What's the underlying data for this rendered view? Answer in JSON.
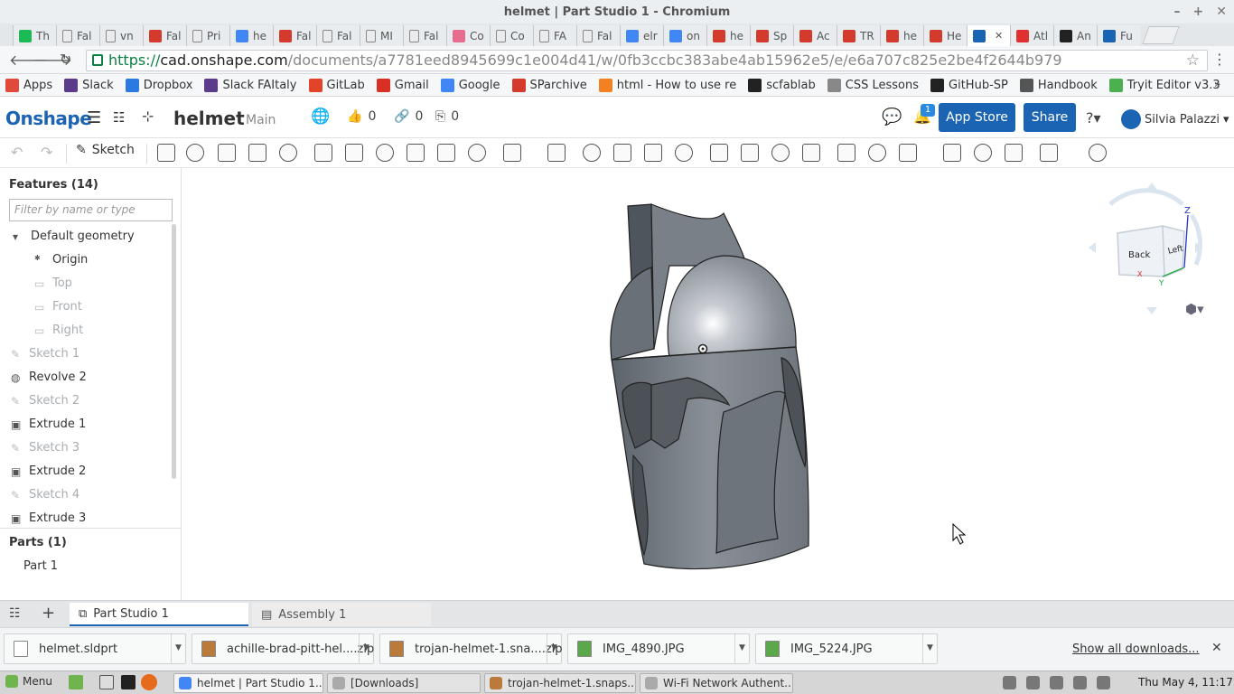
{
  "window": {
    "title": "helmet | Part Studio 1 - Chromium"
  },
  "browser_tabs": [
    {
      "label": "Th",
      "icon": "green-square",
      "color": "#1db954"
    },
    {
      "label": "Fal",
      "icon": "document",
      "color": "#888888"
    },
    {
      "label": "vn",
      "icon": "document",
      "color": "#888888"
    },
    {
      "label": "Fal",
      "icon": "fab-logo",
      "color": "#d53b2c"
    },
    {
      "label": "Pri",
      "icon": "document",
      "color": "#888888"
    },
    {
      "label": "he",
      "icon": "google",
      "color": "#4285f4"
    },
    {
      "label": "Fal",
      "icon": "fab-logo",
      "color": "#d53b2c"
    },
    {
      "label": "Fal",
      "icon": "document",
      "color": "#888888"
    },
    {
      "label": "MI",
      "icon": "document",
      "color": "#888888"
    },
    {
      "label": "Fal",
      "icon": "document",
      "color": "#888888"
    },
    {
      "label": "Co",
      "icon": "colors",
      "color": "#e86c8d"
    },
    {
      "label": "Co",
      "icon": "document",
      "color": "#888888"
    },
    {
      "label": "FA",
      "icon": "document",
      "color": "#888888"
    },
    {
      "label": "Fal",
      "icon": "document",
      "color": "#888888"
    },
    {
      "label": "elr",
      "icon": "google",
      "color": "#4285f4"
    },
    {
      "label": "on",
      "icon": "google",
      "color": "#4285f4"
    },
    {
      "label": "he",
      "icon": "gc",
      "color": "#d33b2c"
    },
    {
      "label": "Sp",
      "icon": "gc",
      "color": "#d33b2c"
    },
    {
      "label": "Ac",
      "icon": "gc",
      "color": "#d33b2c"
    },
    {
      "label": "TR",
      "icon": "gc",
      "color": "#d33b2c"
    },
    {
      "label": "he",
      "icon": "gc",
      "color": "#d33b2c"
    },
    {
      "label": "He",
      "icon": "gc",
      "color": "#d33b2c"
    },
    {
      "label": "",
      "icon": "onshape",
      "color": "#1b64b4"
    },
    {
      "label": "Atl",
      "icon": "red",
      "color": "#e03030"
    },
    {
      "label": "An",
      "icon": "amazon",
      "color": "#222222"
    },
    {
      "label": "Fu",
      "icon": "onshape-round",
      "color": "#1b64b4"
    }
  ],
  "omnibox": {
    "scheme": "https://",
    "host": "cad.onshape.com",
    "path": "/documents/a7781eed8945699c1e004d41/w/0fb3ccbc383abe4ab15962e5/e/e6a707c825e2be4f2644b979"
  },
  "bookmarks": [
    {
      "label": "Apps",
      "color": "#e04a3a"
    },
    {
      "label": "Slack",
      "color": "#5b3b8a"
    },
    {
      "label": "Dropbox",
      "color": "#2a7ae2"
    },
    {
      "label": "Slack FAItaly",
      "color": "#5b3b8a"
    },
    {
      "label": "GitLab",
      "color": "#e24329"
    },
    {
      "label": "Gmail",
      "color": "#d93025"
    },
    {
      "label": "Google",
      "color": "#4285f4"
    },
    {
      "label": "SParchive",
      "color": "#d53b2c"
    },
    {
      "label": "html - How to use re",
      "color": "#f48024"
    },
    {
      "label": "scfablab",
      "color": "#222222"
    },
    {
      "label": "CSS Lessons",
      "color": "#888888"
    },
    {
      "label": "GitHub-SP",
      "color": "#222222"
    },
    {
      "label": "Handbook",
      "color": "#555555"
    },
    {
      "label": "Tryit Editor v3.3",
      "color": "#4caf50"
    }
  ],
  "onshape": {
    "logo": "Onshape",
    "doc_name": "helmet",
    "branch": "Main",
    "likes": "0",
    "links": "0",
    "copies": "0",
    "notifications": "1",
    "app_store": "App Store",
    "share": "Share",
    "user": "Silvia Palazzi",
    "accent": "#1b64b4"
  },
  "toolbar": {
    "sketch_label": "Sketch"
  },
  "features": {
    "header": "Features (14)",
    "filter_placeholder": "Filter by name or type",
    "items": [
      {
        "label": "Default geometry",
        "kind": "group"
      },
      {
        "label": "Origin",
        "kind": "origin"
      },
      {
        "label": "Top",
        "kind": "plane"
      },
      {
        "label": "Front",
        "kind": "plane"
      },
      {
        "label": "Right",
        "kind": "plane"
      },
      {
        "label": "Sketch 1",
        "kind": "sketch"
      },
      {
        "label": "Revolve 2",
        "kind": "revolve"
      },
      {
        "label": "Sketch 2",
        "kind": "sketch"
      },
      {
        "label": "Extrude 1",
        "kind": "extrude"
      },
      {
        "label": "Sketch 3",
        "kind": "sketch"
      },
      {
        "label": "Extrude 2",
        "kind": "extrude"
      },
      {
        "label": "Sketch 4",
        "kind": "sketch"
      },
      {
        "label": "Extrude 3",
        "kind": "extrude"
      }
    ]
  },
  "parts": {
    "header": "Parts (1)",
    "items": [
      {
        "label": "Part 1"
      }
    ]
  },
  "view_cube": {
    "back": "Back",
    "left": "Left",
    "z": "Z",
    "y": "Y",
    "x": "X"
  },
  "element_tabs": [
    {
      "label": "Part Studio 1",
      "active": true
    },
    {
      "label": "Assembly 1",
      "active": false
    }
  ],
  "downloads": [
    {
      "label": "helmet.sldprt",
      "icon": "file-icon"
    },
    {
      "label": "achille-brad-pitt-hel....zip",
      "icon": "zip-icon"
    },
    {
      "label": "trojan-helmet-1.sna....zip",
      "icon": "zip-icon"
    },
    {
      "label": "IMG_4890.JPG",
      "icon": "image-icon"
    },
    {
      "label": "IMG_5224.JPG",
      "icon": "image-icon"
    }
  ],
  "downloads_show_all": "Show all downloads...",
  "taskbar": {
    "menu": "Menu",
    "tasks": [
      {
        "label": "helmet | Part Studio 1...",
        "active": true
      },
      {
        "label": "[Downloads]",
        "active": false
      },
      {
        "label": "trojan-helmet-1.snaps...",
        "active": false
      },
      {
        "label": "Wi-Fi Network Authent...",
        "active": false
      }
    ],
    "clock": "Thu May  4, 11:17"
  }
}
